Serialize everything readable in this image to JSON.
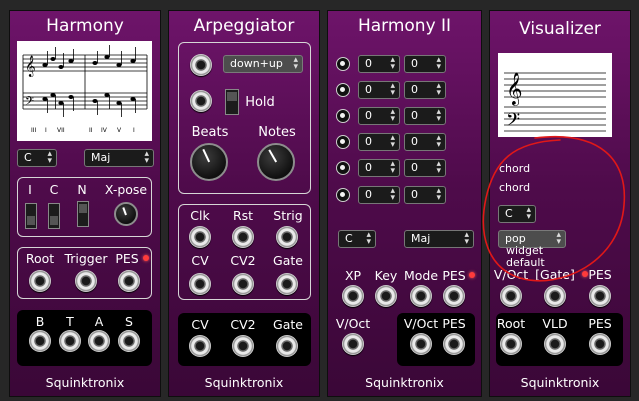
{
  "footer_brand": "Squinktronix",
  "harmony": {
    "title": "Harmony",
    "score_numerals": [
      "III",
      "I",
      "VII",
      "II",
      "IV",
      "V",
      "I"
    ],
    "key": "C",
    "mode": "Maj",
    "toggle_labels": [
      "I",
      "C",
      "N",
      "X-pose"
    ],
    "input_labels": [
      "Root",
      "Trigger",
      "PES"
    ],
    "output_labels": [
      "B",
      "T",
      "A",
      "S"
    ]
  },
  "arpeggiator": {
    "title": "Arpeggiator",
    "mode": "down+up",
    "hold_label": "Hold",
    "beats_label": "Beats",
    "notes_label": "Notes",
    "input_labels": [
      "Clk",
      "Rst",
      "Strig",
      "CV",
      "CV2",
      "Gate"
    ],
    "output_labels": [
      "CV",
      "CV2",
      "Gate"
    ]
  },
  "harmony2": {
    "title": "Harmony II",
    "rows": [
      {
        "a": "0",
        "b": "0"
      },
      {
        "a": "0",
        "b": "0"
      },
      {
        "a": "0",
        "b": "0"
      },
      {
        "a": "0",
        "b": "0"
      },
      {
        "a": "0",
        "b": "0"
      },
      {
        "a": "0",
        "b": "0"
      }
    ],
    "key": "C",
    "mode": "Maj",
    "input_labels": [
      "XP",
      "Key",
      "Mode",
      "PES"
    ],
    "voct_in_label": "V/Oct",
    "output_labels": [
      "V/Oct",
      "PES"
    ]
  },
  "visualizer": {
    "title": "Visualizer",
    "chord_line1": "chord",
    "chord_line2": "chord",
    "key": "C",
    "style": "pop",
    "style_note1": "widget",
    "style_note2": "default",
    "input_labels": [
      "V/Oct",
      "[Gate]",
      "PES"
    ],
    "output_labels": [
      "Root",
      "VLD",
      "PES"
    ]
  },
  "annotation_color": "#e01818"
}
